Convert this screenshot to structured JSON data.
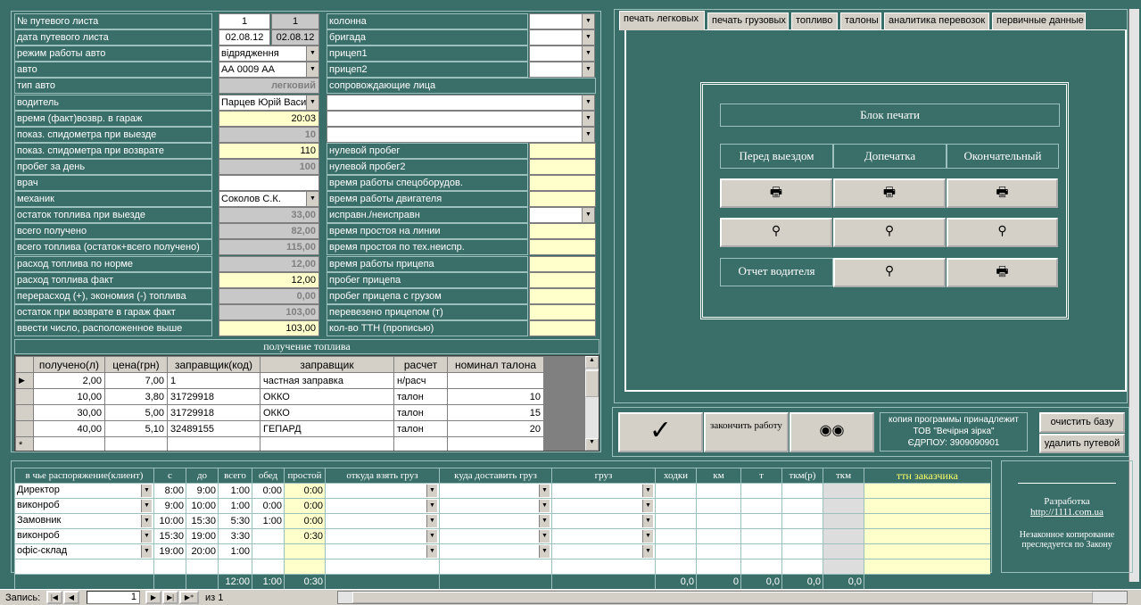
{
  "left_fields": [
    {
      "label": "№ путевого листа",
      "v1": "1",
      "v2": "1"
    },
    {
      "label": "дата путевого листа",
      "v1": "02.08.12",
      "v2": "02.08.12"
    },
    {
      "label": "режим работы авто",
      "combo": "відрядження"
    },
    {
      "label": "авто",
      "combo": "АА 0009 АА"
    },
    {
      "label": "тип авто",
      "gval": "легковий"
    },
    {
      "label": "водитель",
      "combo": "Парцев Юрій Васи"
    },
    {
      "label": "время (факт)возвр. в гараж",
      "yval": "20:03"
    },
    {
      "label": "показ. спидометра при выезде",
      "gval": "10"
    },
    {
      "label": "показ. спидометра при возврате",
      "yval": "110"
    },
    {
      "label": "пробег за день",
      "gval": "100"
    },
    {
      "label": "врач",
      "wval": ""
    },
    {
      "label": "механик",
      "combo": "Соколов С.К."
    },
    {
      "label": "остаток топлива при выезде",
      "gval": "33,00"
    },
    {
      "label": "всего получено",
      "gval": "82,00"
    },
    {
      "label": "всего топлива (остаток+всего получено)",
      "gval": "115,00"
    },
    {
      "label": "расход топлива по норме",
      "gval": "12,00"
    },
    {
      "label": "расход топлива факт",
      "yval": "12,00"
    },
    {
      "label": "перерасход (+), экономия (-) топлива",
      "gval": "0,00"
    },
    {
      "label": "остаток при возврате в гараж  факт",
      "gval": "103,00"
    },
    {
      "label": "ввести число, расположенное выше",
      "yval": "103,00"
    }
  ],
  "mid_fields": [
    {
      "label": "колонна",
      "type": "combo"
    },
    {
      "label": "бригада",
      "type": "combo"
    },
    {
      "label": "прицеп1",
      "type": "combo"
    },
    {
      "label": "прицеп2",
      "type": "combo"
    },
    {
      "label": "сопровождающие лица",
      "type": "none"
    },
    {
      "label": "",
      "type": "wide"
    },
    {
      "label": "",
      "type": "wide"
    },
    {
      "label": "",
      "type": "wide"
    },
    {
      "label": "нулевой пробег",
      "type": "yel"
    },
    {
      "label": "нулевой пробег2",
      "type": "yel"
    },
    {
      "label": "время работы спецоборудов.",
      "type": "yel"
    },
    {
      "label": "время работы двигателя",
      "type": "yel"
    },
    {
      "label": "исправн./неисправн",
      "type": "combo"
    },
    {
      "label": "время простоя на линии",
      "type": "yel"
    },
    {
      "label": "время простоя по тех.неиспр.",
      "type": "yel"
    },
    {
      "label": "время работы прицепа",
      "type": "yel"
    },
    {
      "label": "пробег прицепа",
      "type": "yel"
    },
    {
      "label": "пробег прицепа с грузом",
      "type": "yel"
    },
    {
      "label": "перевезено прицепом (т)",
      "type": "yel"
    },
    {
      "label": "кол-во ТТН (прописью)",
      "type": "yel"
    }
  ],
  "fuel": {
    "title": "получение топлива",
    "headers": [
      "получено(л)",
      "цена(грн)",
      "заправщик(код)",
      "заправщик",
      "расчет",
      "номинал талона"
    ],
    "rows": [
      [
        "2,00",
        "7,00",
        "1",
        "частная заправка",
        "н/расч",
        ""
      ],
      [
        "10,00",
        "3,80",
        "31729918",
        "ОККО",
        "талон",
        "10"
      ],
      [
        "30,00",
        "5,00",
        "31729918",
        "ОККО",
        "талон",
        "15"
      ],
      [
        "40,00",
        "5,10",
        "32489155",
        "ГЕПАРД",
        "талон",
        "20"
      ]
    ]
  },
  "tabs": [
    "печать легковых",
    "печать грузовых",
    "топливо",
    "талоны",
    "аналитика перевозок",
    "первичные данные"
  ],
  "print_block": {
    "title": "Блок печати",
    "cols": [
      "Перед выездом",
      "Допечатка",
      "Окончательный"
    ],
    "driver_report": "Отчет водителя"
  },
  "actions": {
    "finish": "закончить работу",
    "copy_owner_line1": "копия программы  принадлежит",
    "copy_owner_line2": "ТОВ \"Вечірня зірка\"",
    "copy_owner_line3": "ЄДРПОУ: 3909090901",
    "clear_db": "очистить базу",
    "delete_waybill": "удалить путевой"
  },
  "bottom": {
    "headers": [
      "в чье распоряжение(клиент)",
      "с",
      "до",
      "всего",
      "обед",
      "простой",
      "откуда взять груз",
      "куда доставить груз",
      "груз",
      "ходки",
      "км",
      "т",
      "ткм(р)",
      "ткм",
      "ттн заказчика"
    ],
    "rows": [
      [
        "Директор",
        "8:00",
        "9:00",
        "1:00",
        "0:00",
        "0:00"
      ],
      [
        "виконроб",
        "9:00",
        "10:00",
        "1:00",
        "0:00",
        "0:00"
      ],
      [
        "Замовник",
        "10:00",
        "15:30",
        "5:30",
        "1:00",
        "0:00"
      ],
      [
        "виконроб",
        "15:30",
        "19:00",
        "3:30",
        "",
        "0:30"
      ],
      [
        "офіс-склад",
        "19:00",
        "20:00",
        "1:00",
        "",
        ""
      ]
    ],
    "totals": {
      "all": "12:00",
      "lunch": "1:00",
      "idle": "0:30",
      "trips": "0,0",
      "km": "0",
      "t": "0,0",
      "tkmr": "0,0",
      "tkm": "0,0"
    }
  },
  "dev": {
    "line1": "Разработка",
    "link": "http://1111.com.ua",
    "line2": "Незаконное копирование",
    "line3": "преследуется по Закону"
  },
  "status": {
    "label": "Запись:",
    "record": "1",
    "of": "из  1"
  }
}
